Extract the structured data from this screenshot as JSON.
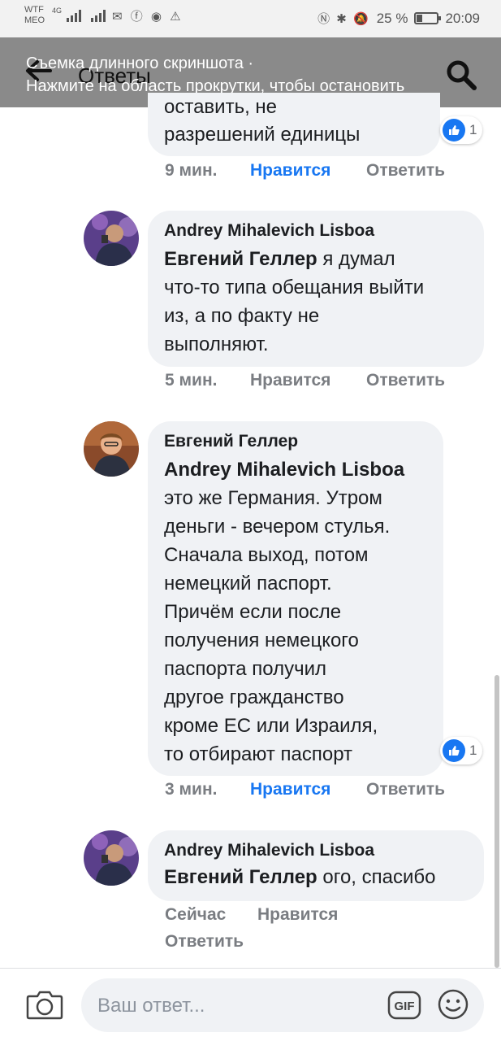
{
  "status_bar": {
    "carrier_top": "WTF",
    "carrier_bottom": "MEO",
    "network": "4G",
    "notif_icons": "✉ ⓕ ◉ ⚠",
    "right_icons": "Ⓝ ✱ 🔕",
    "battery_percent": "25 %",
    "battery_level": 0.25,
    "time": "20:09"
  },
  "header": {
    "title": "Ответы",
    "overlay_line1": "Съемка длинного скриншота ·",
    "overlay_line2": "Нажмите на область прокрутки, чтобы остановить"
  },
  "comments": [
    {
      "author": "",
      "mention": "",
      "text_partial_top": "оставить, не",
      "text": "разрешений единицы",
      "time": "9 мин.",
      "like": "Нравится",
      "reply": "Ответить",
      "liked": true,
      "reactions": "1"
    },
    {
      "author": "Andrey Mihalevich Lisboa",
      "mention": "Евгений Геллер",
      "text_first": " я думал",
      "text_lines": [
        "что-то типа обещания выйти",
        "из, а по факту не",
        "выполняют."
      ],
      "time": "5 мин.",
      "like": "Нравится",
      "reply": "Ответить",
      "liked": false
    },
    {
      "author": "Евгений Геллер",
      "mention": "Andrey Mihalevich Lisboa",
      "text_lines": [
        "это же Германия. Утром",
        "деньги - вечером стулья.",
        "Сначала выход, потом",
        "немецкий паспорт.",
        "Причём если после",
        "получения немецкого",
        "паспорта получил",
        "другое гражданство",
        "кроме ЕС или Израиля,",
        "то отбирают паспорт"
      ],
      "time": "3 мин.",
      "like": "Нравится",
      "reply": "Ответить",
      "liked": true,
      "reactions": "1"
    },
    {
      "author": "Andrey Mihalevich Lisboa",
      "mention": "Евгений Геллер",
      "text_first": " ого, спасибо",
      "time": "Сейчас",
      "like": "Нравится",
      "reply": "Ответить",
      "liked": false
    }
  ],
  "composer": {
    "placeholder": "Ваш ответ...",
    "gif_label": "GIF"
  },
  "icons": {
    "back": "back-arrow-icon",
    "search": "search-icon",
    "camera": "camera-icon",
    "gif": "gif-icon",
    "emoji": "emoji-icon",
    "like_reaction": "thumbs-up-icon"
  },
  "colors": {
    "accent_blue": "#1877f2",
    "bubble_bg": "#f0f2f5",
    "meta_gray": "#7a7d82",
    "header_overlay": "#8a8a8a"
  }
}
